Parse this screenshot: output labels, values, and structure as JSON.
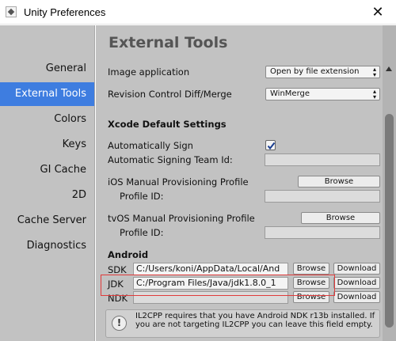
{
  "window": {
    "title": "Unity Preferences",
    "close_glyph": "✕"
  },
  "sidebar": {
    "items": [
      {
        "label": "General"
      },
      {
        "label": "External Tools",
        "selected": true
      },
      {
        "label": "Colors"
      },
      {
        "label": "Keys"
      },
      {
        "label": "GI Cache"
      },
      {
        "label": "2D"
      },
      {
        "label": "Cache Server"
      },
      {
        "label": "Diagnostics"
      }
    ]
  },
  "main": {
    "title": "External Tools",
    "image_application": {
      "label": "Image application",
      "value": "Open by file extension"
    },
    "revision_control": {
      "label": "Revision Control Diff/Merge",
      "value": "WinMerge"
    },
    "xcode": {
      "section": "Xcode Default Settings",
      "auto_sign": {
        "label": "Automatically Sign",
        "checked": true
      },
      "team_id": {
        "label": "Automatic Signing Team Id:",
        "value": ""
      },
      "ios_profile": {
        "label": "iOS Manual Provisioning Profile",
        "browse": "Browse",
        "profile_id_label": "Profile ID:",
        "profile_id_value": ""
      },
      "tvos_profile": {
        "label": "tvOS Manual Provisioning Profile",
        "browse": "Browse",
        "profile_id_label": "Profile ID:",
        "profile_id_value": ""
      }
    },
    "android": {
      "section": "Android",
      "sdk": {
        "label": "SDK",
        "path": "C:/Users/koni/AppData/Local/And",
        "browse": "Browse",
        "download": "Download"
      },
      "jdk": {
        "label": "JDK",
        "path": "C:/Program Files/Java/jdk1.8.0_1",
        "browse": "Browse",
        "download": "Download"
      },
      "ndk": {
        "label": "NDK",
        "path": "",
        "browse": "Browse",
        "download": "Download"
      },
      "help_text": "IL2CPP requires that you have Android NDK r13b installed. If you are not targeting IL2CPP you can leave this field empty.",
      "help_icon_glyph": "!"
    }
  },
  "colors": {
    "selection": "#3e7de0",
    "highlight_box": "#e03b3b"
  }
}
